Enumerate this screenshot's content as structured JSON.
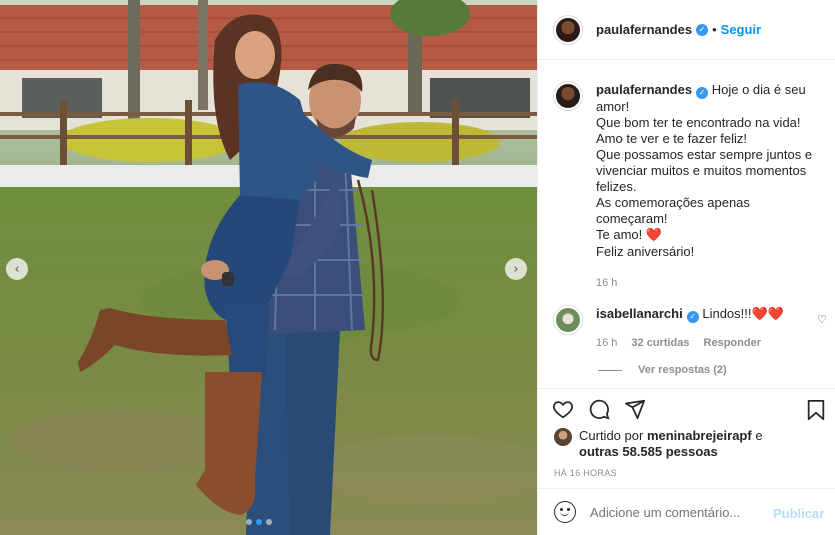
{
  "post": {
    "author": "paulafernandes",
    "follow_label": "Seguir",
    "separator": "•",
    "caption": "Hoje o dia é seu amor!\nQue bom ter te encontrado na vida!\nAmo te ver e te fazer feliz!\nQue possamos estar sempre juntos e vivenciar muitos e muitos momentos felizes.\nAs comemorações apenas começaram!\nTe amo! ",
    "caption_heart": "❤️",
    "caption_end": "Feliz aniversário!",
    "caption_time": "16 h"
  },
  "carousel": {
    "prev_icon": "chevron-left-icon",
    "next_icon": "chevron-right-icon",
    "prev_glyph": "‹",
    "next_glyph": "›",
    "dots": 3,
    "active_dot": 1
  },
  "comment": {
    "user": "isabellanarchi",
    "text": "Lindos!!!",
    "hearts": "❤️❤️",
    "time": "16 h",
    "likes": "32 curtidas",
    "reply_label": "Responder",
    "view_replies": "Ver respostas (2)"
  },
  "actions": {
    "like_icon": "heart-icon",
    "comment_icon": "comment-icon",
    "share_icon": "share-icon",
    "save_icon": "bookmark-icon"
  },
  "likes": {
    "prefix": "Curtido por",
    "user": "meninabrejeirapf",
    "suffix": "e",
    "others": "outras 58.585 pessoas"
  },
  "timestamp": "HÁ 16 HORAS",
  "add_comment": {
    "placeholder": "Adicione um comentário...",
    "publish_label": "Publicar",
    "emoji_icon": "emoji-icon"
  },
  "colors": {
    "accent": "#0095f6",
    "verified": "#3897f0",
    "heart": "#ed4956",
    "publish_disabled": "#b2dffc"
  }
}
